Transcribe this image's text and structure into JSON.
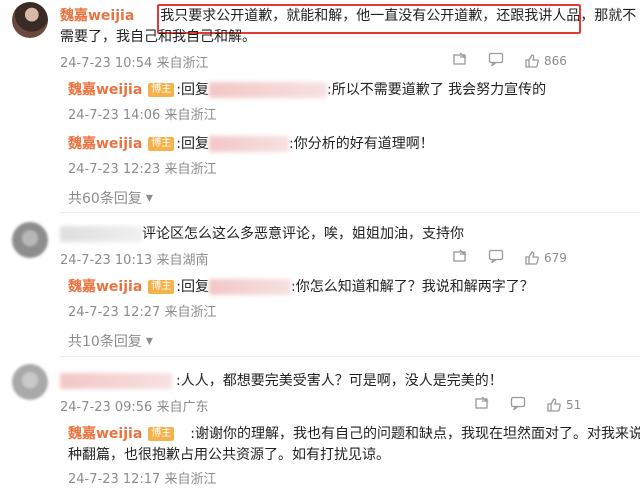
{
  "comments": [
    {
      "user": "魏嘉weijia",
      "badge": "博主",
      "text1": "我只要求公开道歉，就能和解，他一直没有公开道歉，还跟我讲人品",
      "text2": "，那就不",
      "text3": "需要了，我自己和我自己和解。",
      "meta": "24-7-23 10:54 来自浙江",
      "likes": "866",
      "replies": [
        {
          "user": "魏嘉weijia",
          "badge": "博主",
          "prefix": ":回复",
          "text": ":所以不需要道歉了 我会努力宣传的",
          "meta": "24-7-23 14:06 来自浙江"
        },
        {
          "user": "魏嘉weijia",
          "badge": "博主",
          "prefix": ":回复",
          "text": ":你分析的好有道理啊！",
          "meta": "24-7-23 12:23 来自浙江"
        }
      ],
      "more": "共60条回复"
    },
    {
      "text": "评论区怎么这么多恶意评论，唉，姐姐加油，支持你",
      "meta": "24-7-23 10:13 来自湖南",
      "likes": "679",
      "replies": [
        {
          "user": "魏嘉weijia",
          "badge": "博主",
          "prefix": ":回复",
          "text": ":你怎么知道和解了？我说和解两字了？",
          "meta": "24-7-23 12:27 来自浙江"
        }
      ],
      "more": "共10条回复"
    },
    {
      "text": ":人人，都想要完美受害人？可是啊，没人是完美的！",
      "meta": "24-7-23 09:56 来自广东",
      "likes": "51",
      "replies": [
        {
          "user": "魏嘉weijia",
          "badge": "博主",
          "text1": ":谢谢你的理解，我也有自己的问题和缺点，我现在坦然面对了。对我来说是一",
          "text2": "种翻篇，也很抱歉占用公共资源了。如有打扰见谅。",
          "meta": "24-7-23 12:17 来自浙江"
        }
      ]
    }
  ]
}
